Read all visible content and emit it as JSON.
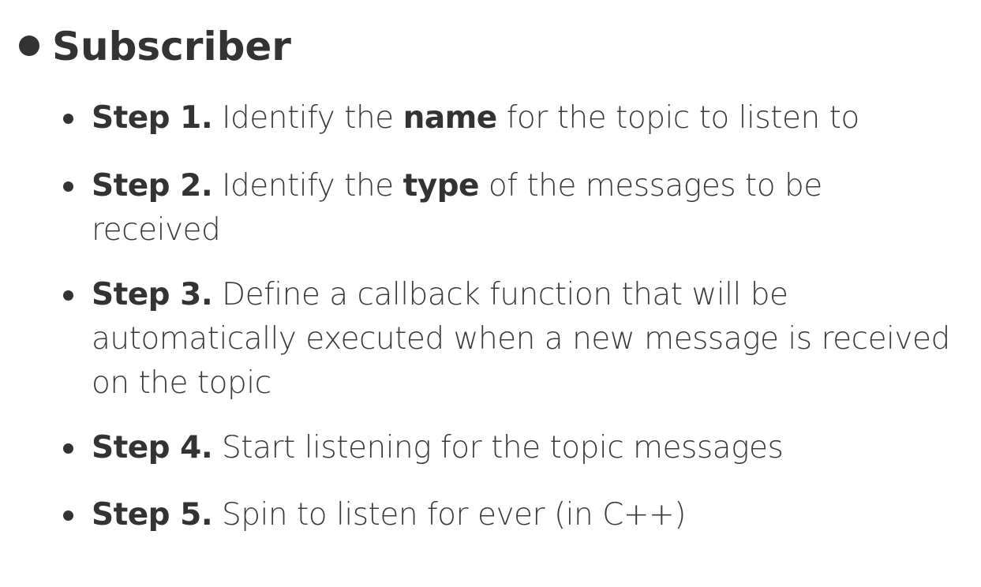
{
  "heading": "Subscriber",
  "steps": [
    {
      "label": "Step 1.",
      "pre": " Identify the ",
      "bold": "name",
      "post": " for the topic to listen to"
    },
    {
      "label": "Step 2.",
      "pre": " Identify the ",
      "bold": "type",
      "post": " of the messages to be received"
    },
    {
      "label": "Step 3.",
      "pre": " Define a callback function that will be automatically executed when a new message is received on the topic",
      "bold": "",
      "post": ""
    },
    {
      "label": "Step 4.",
      "pre": " Start listening for the topic messages",
      "bold": "",
      "post": ""
    },
    {
      "label": "Step 5.",
      "pre": " Spin to listen for ever (in C++)",
      "bold": "",
      "post": ""
    }
  ]
}
